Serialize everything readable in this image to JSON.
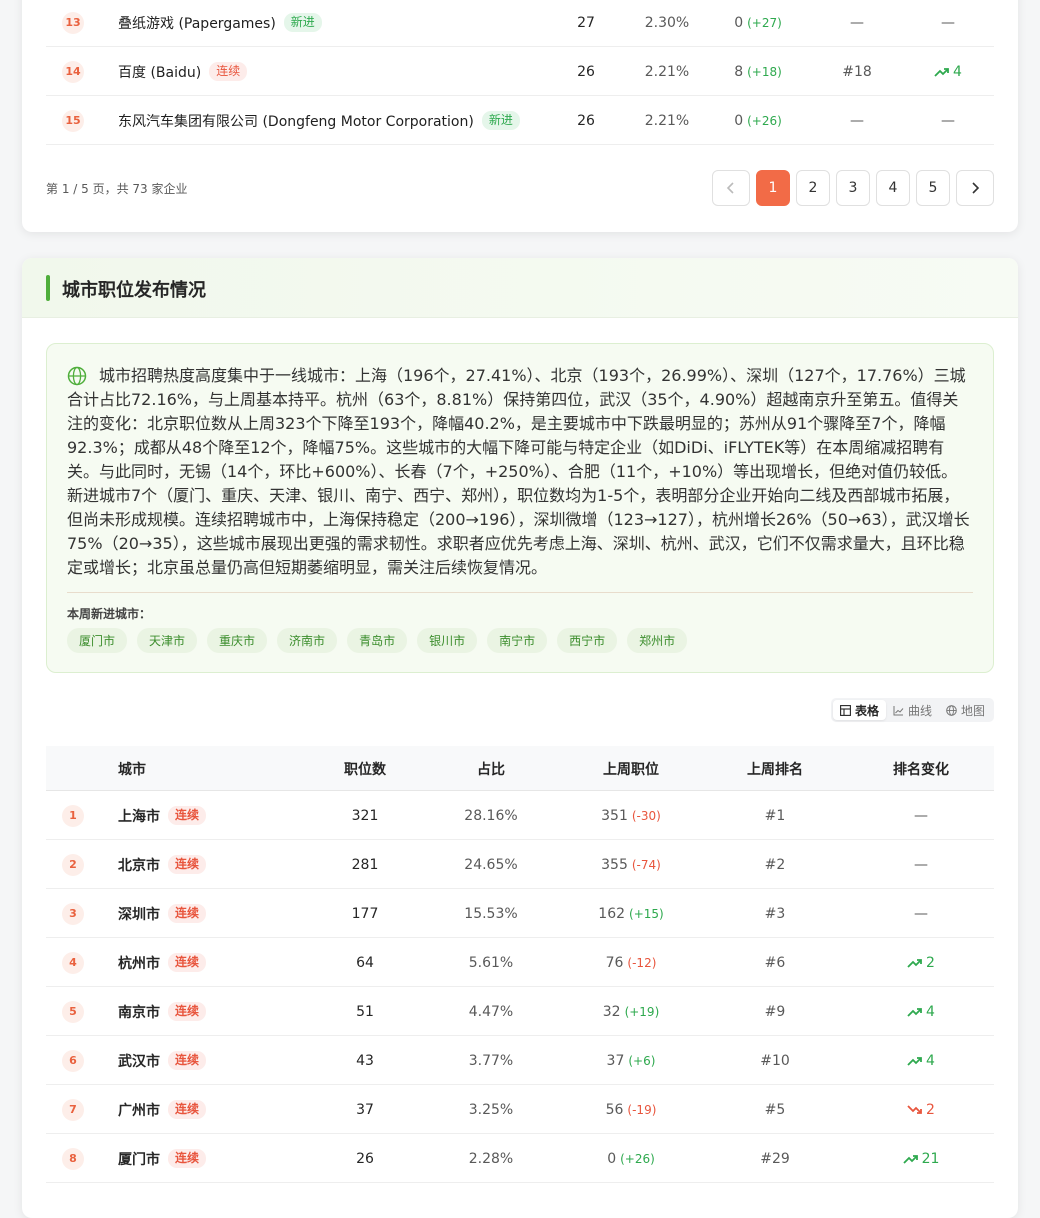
{
  "company_table": {
    "rows": [
      {
        "rank": "13",
        "name": "叠纸游戏 (Papergames)",
        "tag": "新进",
        "tag_type": "new",
        "count": "27",
        "pct": "2.30%",
        "last": "0",
        "delta": "(+27)",
        "delta_dir": "up",
        "last_rank": "—",
        "change": "—",
        "change_dir": "none"
      },
      {
        "rank": "14",
        "name": "百度 (Baidu)",
        "tag": "连续",
        "tag_type": "cont",
        "count": "26",
        "pct": "2.21%",
        "last": "8",
        "delta": "(+18)",
        "delta_dir": "up",
        "last_rank": "#18",
        "change": "4",
        "change_dir": "up"
      },
      {
        "rank": "15",
        "name": "东风汽车集团有限公司 (Dongfeng Motor Corporation)",
        "tag": "新进",
        "tag_type": "new",
        "count": "26",
        "pct": "2.21%",
        "last": "0",
        "delta": "(+26)",
        "delta_dir": "up",
        "last_rank": "—",
        "change": "—",
        "change_dir": "none"
      }
    ],
    "pager_info": "第 1 / 5 页，共 73 家企业",
    "pages": [
      "1",
      "2",
      "3",
      "4",
      "5"
    ],
    "active_page": "1"
  },
  "city_section": {
    "title": "城市职位发布情况",
    "insight": "城市招聘热度高度集中于一线城市：上海（196个，27.41%）、北京（193个，26.99%）、深圳（127个，17.76%）三城合计占比72.16%，与上周基本持平。杭州（63个，8.81%）保持第四位，武汉（35个，4.90%）超越南京升至第五。值得关注的变化：北京职位数从上周323个下降至193个，降幅40.2%，是主要城市中下跌最明显的；苏州从91个骤降至7个，降幅92.3%；成都从48个降至12个，降幅75%。这些城市的大幅下降可能与特定企业（如DiDi、iFLYTEK等）在本周缩减招聘有关。与此同时，无锡（14个，环比+600%）、长春（7个，+250%）、合肥（11个，+10%）等出现增长，但绝对值仍较低。新进城市7个（厦门、重庆、天津、银川、南宁、西宁、郑州），职位数均为1-5个，表明部分企业开始向二线及西部城市拓展，但尚未形成规模。连续招聘城市中，上海保持稳定（200→196），深圳微增（123→127），杭州增长26%（50→63），武汉增长75%（20→35），这些城市展现出更强的需求韧性。求职者应优先考虑上海、深圳、杭州、武汉，它们不仅需求量大，且环比稳定或增长；北京虽总量仍高但短期萎缩明显，需关注后续恢复情况。",
    "new_cities_label": "本周新进城市：",
    "new_cities": [
      "厦门市",
      "天津市",
      "重庆市",
      "济南市",
      "青岛市",
      "银川市",
      "南宁市",
      "西宁市",
      "郑州市"
    ],
    "view_tabs": [
      "表格",
      "曲线",
      "地图"
    ],
    "active_view": "表格",
    "columns": [
      "城市",
      "职位数",
      "占比",
      "上周职位",
      "上周排名",
      "排名变化"
    ],
    "rows": [
      {
        "rank": "1",
        "city": "上海市",
        "tag": "连续",
        "count": "321",
        "pct": "28.16%",
        "last": "351",
        "delta": "(-30)",
        "delta_dir": "down",
        "last_rank": "#1",
        "change": "—",
        "change_dir": "none"
      },
      {
        "rank": "2",
        "city": "北京市",
        "tag": "连续",
        "count": "281",
        "pct": "24.65%",
        "last": "355",
        "delta": "(-74)",
        "delta_dir": "down",
        "last_rank": "#2",
        "change": "—",
        "change_dir": "none"
      },
      {
        "rank": "3",
        "city": "深圳市",
        "tag": "连续",
        "count": "177",
        "pct": "15.53%",
        "last": "162",
        "delta": "(+15)",
        "delta_dir": "up",
        "last_rank": "#3",
        "change": "—",
        "change_dir": "none"
      },
      {
        "rank": "4",
        "city": "杭州市",
        "tag": "连续",
        "count": "64",
        "pct": "5.61%",
        "last": "76",
        "delta": "(-12)",
        "delta_dir": "down",
        "last_rank": "#6",
        "change": "2",
        "change_dir": "up"
      },
      {
        "rank": "5",
        "city": "南京市",
        "tag": "连续",
        "count": "51",
        "pct": "4.47%",
        "last": "32",
        "delta": "(+19)",
        "delta_dir": "up",
        "last_rank": "#9",
        "change": "4",
        "change_dir": "up"
      },
      {
        "rank": "6",
        "city": "武汉市",
        "tag": "连续",
        "count": "43",
        "pct": "3.77%",
        "last": "37",
        "delta": "(+6)",
        "delta_dir": "up",
        "last_rank": "#10",
        "change": "4",
        "change_dir": "up"
      },
      {
        "rank": "7",
        "city": "广州市",
        "tag": "连续",
        "count": "37",
        "pct": "3.25%",
        "last": "56",
        "delta": "(-19)",
        "delta_dir": "down",
        "last_rank": "#5",
        "change": "2",
        "change_dir": "down"
      },
      {
        "rank": "8",
        "city": "厦门市",
        "tag": "连续",
        "count": "26",
        "pct": "2.28%",
        "last": "0",
        "delta": "(+26)",
        "delta_dir": "up",
        "last_rank": "#29",
        "change": "21",
        "change_dir": "up"
      }
    ]
  }
}
